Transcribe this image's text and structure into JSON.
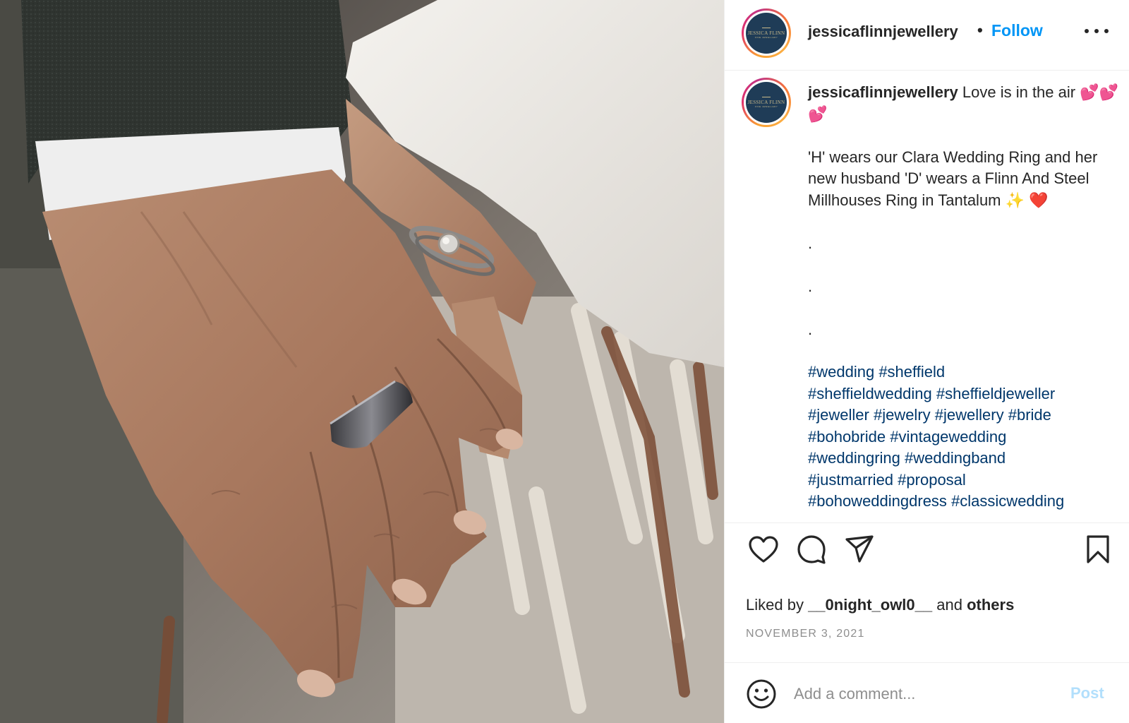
{
  "photo": {
    "description_icon": "wedding-rings-photo"
  },
  "header": {
    "username": "jessicaflinnjewellery",
    "separator": "•",
    "follow_label": "Follow",
    "avatar_brand": "JESSICA FLINN",
    "avatar_sub": "FINE JEWELLERY"
  },
  "caption": {
    "username": "jessicaflinnjewellery",
    "text": " Love is in the air 💕💕💕\n\n'H' wears our Clara Wedding Ring and her new husband 'D' wears a Flinn And Steel Millhouses Ring in Tantalum ✨ ❤️\n\n.\n\n.\n\n.",
    "hashtag_lines": [
      [
        "#wedding",
        "#sheffield"
      ],
      [
        "#sheffieldwedding",
        "#sheffieldjeweller"
      ],
      [
        "#jeweller",
        "#jewelry",
        "#jewellery",
        "#bride"
      ],
      [
        "#bohobride",
        "#vintagewedding"
      ],
      [
        "#weddingring",
        "#weddingband"
      ],
      [
        "#justmarried",
        "#proposal"
      ],
      [
        "#bohoweddingdress",
        "#classicwedding"
      ]
    ]
  },
  "actions": {
    "like_icon": "heart-icon",
    "comment_icon": "comment-icon",
    "share_icon": "paper-plane-icon",
    "save_icon": "bookmark-icon"
  },
  "likes": {
    "prefix": "Liked by ",
    "user": "__0night_owl0__",
    "middle": " and ",
    "others": "others"
  },
  "date": "NOVEMBER 3, 2021",
  "comment": {
    "placeholder": "Add a comment...",
    "post_label": "Post",
    "emoji_icon": "smiley-icon"
  },
  "colors": {
    "link": "#0095f6",
    "hashtag": "#00376b",
    "post_disabled": "#b2dffc",
    "muted": "#8e8e8e"
  }
}
